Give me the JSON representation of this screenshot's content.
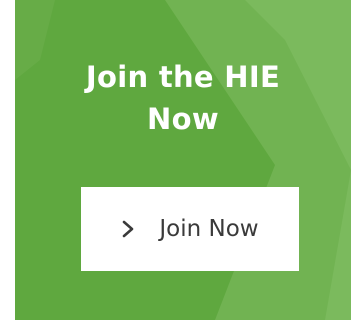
{
  "cta": {
    "heading_line1": "Join the HIE",
    "heading_line2": "Now",
    "button_label": "Join Now",
    "button_icon": "chevron-right-icon"
  },
  "colors": {
    "panel_bg": "#5fa83f",
    "panel_shape_light": "#7ab95c",
    "heading_text": "#ffffff",
    "button_bg": "#ffffff",
    "button_text": "#3a3a3a"
  }
}
